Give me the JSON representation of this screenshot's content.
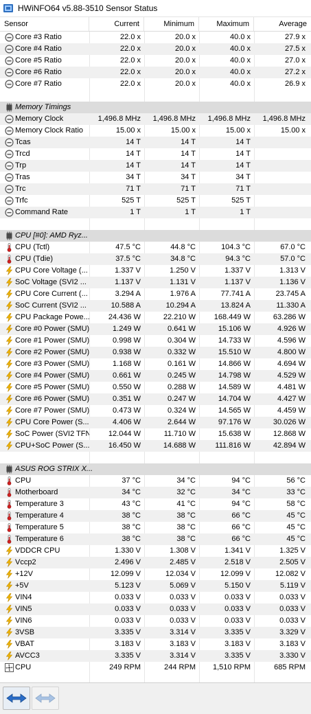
{
  "window": {
    "title": "HWiNFO64 v5.88-3510 Sensor Status"
  },
  "columns": {
    "sensor": "Sensor",
    "current": "Current",
    "minimum": "Minimum",
    "maximum": "Maximum",
    "average": "Average"
  },
  "rows": [
    {
      "type": "item",
      "icon": "clock",
      "name": "Core #3 Ratio",
      "cur": "22.0 x",
      "min": "20.0 x",
      "max": "40.0 x",
      "avg": "27.9 x"
    },
    {
      "type": "item",
      "icon": "clock",
      "name": "Core #4 Ratio",
      "cur": "22.0 x",
      "min": "20.0 x",
      "max": "40.0 x",
      "avg": "27.5 x"
    },
    {
      "type": "item",
      "icon": "clock",
      "name": "Core #5 Ratio",
      "cur": "22.0 x",
      "min": "20.0 x",
      "max": "40.0 x",
      "avg": "27.0 x"
    },
    {
      "type": "item",
      "icon": "clock",
      "name": "Core #6 Ratio",
      "cur": "22.0 x",
      "min": "20.0 x",
      "max": "40.0 x",
      "avg": "27.2 x"
    },
    {
      "type": "item",
      "icon": "clock",
      "name": "Core #7 Ratio",
      "cur": "22.0 x",
      "min": "20.0 x",
      "max": "40.0 x",
      "avg": "26.9 x"
    },
    {
      "type": "blank"
    },
    {
      "type": "group",
      "icon": "chip",
      "name": "Memory Timings"
    },
    {
      "type": "item",
      "icon": "clock",
      "name": "Memory Clock",
      "cur": "1,496.8 MHz",
      "min": "1,496.8 MHz",
      "max": "1,496.8 MHz",
      "avg": "1,496.8 MHz"
    },
    {
      "type": "item",
      "icon": "clock",
      "name": "Memory Clock Ratio",
      "cur": "15.00 x",
      "min": "15.00 x",
      "max": "15.00 x",
      "avg": "15.00 x"
    },
    {
      "type": "item",
      "icon": "clock",
      "name": "Tcas",
      "cur": "14 T",
      "min": "14 T",
      "max": "14 T",
      "avg": ""
    },
    {
      "type": "item",
      "icon": "clock",
      "name": "Trcd",
      "cur": "14 T",
      "min": "14 T",
      "max": "14 T",
      "avg": ""
    },
    {
      "type": "item",
      "icon": "clock",
      "name": "Trp",
      "cur": "14 T",
      "min": "14 T",
      "max": "14 T",
      "avg": ""
    },
    {
      "type": "item",
      "icon": "clock",
      "name": "Tras",
      "cur": "34 T",
      "min": "34 T",
      "max": "34 T",
      "avg": ""
    },
    {
      "type": "item",
      "icon": "clock",
      "name": "Trc",
      "cur": "71 T",
      "min": "71 T",
      "max": "71 T",
      "avg": ""
    },
    {
      "type": "item",
      "icon": "clock",
      "name": "Trfc",
      "cur": "525 T",
      "min": "525 T",
      "max": "525 T",
      "avg": ""
    },
    {
      "type": "item",
      "icon": "clock",
      "name": "Command Rate",
      "cur": "1 T",
      "min": "1 T",
      "max": "1 T",
      "avg": ""
    },
    {
      "type": "blank"
    },
    {
      "type": "group",
      "icon": "chip",
      "name": "CPU [#0]: AMD Ryz..."
    },
    {
      "type": "item",
      "icon": "thermo",
      "name": "CPU (Tctl)",
      "cur": "47.5 °C",
      "min": "44.8 °C",
      "max": "104.3 °C",
      "avg": "67.0 °C"
    },
    {
      "type": "item",
      "icon": "thermo",
      "name": "CPU (Tdie)",
      "cur": "37.5 °C",
      "min": "34.8 °C",
      "max": "94.3 °C",
      "avg": "57.0 °C"
    },
    {
      "type": "item",
      "icon": "bolt",
      "name": "CPU Core Voltage (...",
      "cur": "1.337 V",
      "min": "1.250 V",
      "max": "1.337 V",
      "avg": "1.313 V"
    },
    {
      "type": "item",
      "icon": "bolt",
      "name": "SoC Voltage (SVI2 ...",
      "cur": "1.137 V",
      "min": "1.131 V",
      "max": "1.137 V",
      "avg": "1.136 V"
    },
    {
      "type": "item",
      "icon": "bolt",
      "name": "CPU Core Current (...",
      "cur": "3.294 A",
      "min": "1.976 A",
      "max": "77.741 A",
      "avg": "23.745 A"
    },
    {
      "type": "item",
      "icon": "bolt",
      "name": "SoC Current (SVI2 ...",
      "cur": "10.588 A",
      "min": "10.294 A",
      "max": "13.824 A",
      "avg": "11.330 A"
    },
    {
      "type": "item",
      "icon": "bolt",
      "name": "CPU Package Powe...",
      "cur": "24.436 W",
      "min": "22.210 W",
      "max": "168.449 W",
      "avg": "63.286 W"
    },
    {
      "type": "item",
      "icon": "bolt",
      "name": "Core #0 Power (SMU)",
      "cur": "1.249 W",
      "min": "0.641 W",
      "max": "15.106 W",
      "avg": "4.926 W"
    },
    {
      "type": "item",
      "icon": "bolt",
      "name": "Core #1 Power (SMU)",
      "cur": "0.998 W",
      "min": "0.304 W",
      "max": "14.733 W",
      "avg": "4.596 W"
    },
    {
      "type": "item",
      "icon": "bolt",
      "name": "Core #2 Power (SMU)",
      "cur": "0.938 W",
      "min": "0.332 W",
      "max": "15.510 W",
      "avg": "4.800 W"
    },
    {
      "type": "item",
      "icon": "bolt",
      "name": "Core #3 Power (SMU)",
      "cur": "1.168 W",
      "min": "0.161 W",
      "max": "14.866 W",
      "avg": "4.694 W"
    },
    {
      "type": "item",
      "icon": "bolt",
      "name": "Core #4 Power (SMU)",
      "cur": "0.661 W",
      "min": "0.245 W",
      "max": "14.798 W",
      "avg": "4.529 W"
    },
    {
      "type": "item",
      "icon": "bolt",
      "name": "Core #5 Power (SMU)",
      "cur": "0.550 W",
      "min": "0.288 W",
      "max": "14.589 W",
      "avg": "4.481 W"
    },
    {
      "type": "item",
      "icon": "bolt",
      "name": "Core #6 Power (SMU)",
      "cur": "0.351 W",
      "min": "0.247 W",
      "max": "14.704 W",
      "avg": "4.427 W"
    },
    {
      "type": "item",
      "icon": "bolt",
      "name": "Core #7 Power (SMU)",
      "cur": "0.473 W",
      "min": "0.324 W",
      "max": "14.565 W",
      "avg": "4.459 W"
    },
    {
      "type": "item",
      "icon": "bolt",
      "name": "CPU Core Power (S...",
      "cur": "4.406 W",
      "min": "2.644 W",
      "max": "97.176 W",
      "avg": "30.026 W"
    },
    {
      "type": "item",
      "icon": "bolt",
      "name": "SoC Power (SVI2 TFN)",
      "cur": "12.044 W",
      "min": "11.710 W",
      "max": "15.638 W",
      "avg": "12.868 W"
    },
    {
      "type": "item",
      "icon": "bolt",
      "name": "CPU+SoC Power (S...",
      "cur": "16.450 W",
      "min": "14.688 W",
      "max": "111.816 W",
      "avg": "42.894 W"
    },
    {
      "type": "blank"
    },
    {
      "type": "group",
      "icon": "chip",
      "name": "ASUS ROG STRIX X..."
    },
    {
      "type": "item",
      "icon": "thermo",
      "name": "CPU",
      "cur": "37 °C",
      "min": "34 °C",
      "max": "94 °C",
      "avg": "56 °C"
    },
    {
      "type": "item",
      "icon": "thermo",
      "name": "Motherboard",
      "cur": "34 °C",
      "min": "32 °C",
      "max": "34 °C",
      "avg": "33 °C"
    },
    {
      "type": "item",
      "icon": "thermo",
      "name": "Temperature 3",
      "cur": "43 °C",
      "min": "41 °C",
      "max": "94 °C",
      "avg": "58 °C"
    },
    {
      "type": "item",
      "icon": "thermo",
      "name": "Temperature 4",
      "cur": "38 °C",
      "min": "38 °C",
      "max": "66 °C",
      "avg": "45 °C"
    },
    {
      "type": "item",
      "icon": "thermo",
      "name": "Temperature 5",
      "cur": "38 °C",
      "min": "38 °C",
      "max": "66 °C",
      "avg": "45 °C"
    },
    {
      "type": "item",
      "icon": "thermo",
      "name": "Temperature 6",
      "cur": "38 °C",
      "min": "38 °C",
      "max": "66 °C",
      "avg": "45 °C"
    },
    {
      "type": "item",
      "icon": "bolt",
      "name": "VDDCR CPU",
      "cur": "1.330 V",
      "min": "1.308 V",
      "max": "1.341 V",
      "avg": "1.325 V"
    },
    {
      "type": "item",
      "icon": "bolt",
      "name": "Vccp2",
      "cur": "2.496 V",
      "min": "2.485 V",
      "max": "2.518 V",
      "avg": "2.505 V"
    },
    {
      "type": "item",
      "icon": "bolt",
      "name": "+12V",
      "cur": "12.099 V",
      "min": "12.034 V",
      "max": "12.099 V",
      "avg": "12.082 V"
    },
    {
      "type": "item",
      "icon": "bolt",
      "name": "+5V",
      "cur": "5.123 V",
      "min": "5.069 V",
      "max": "5.150 V",
      "avg": "5.119 V"
    },
    {
      "type": "item",
      "icon": "bolt",
      "name": "VIN4",
      "cur": "0.033 V",
      "min": "0.033 V",
      "max": "0.033 V",
      "avg": "0.033 V"
    },
    {
      "type": "item",
      "icon": "bolt",
      "name": "VIN5",
      "cur": "0.033 V",
      "min": "0.033 V",
      "max": "0.033 V",
      "avg": "0.033 V"
    },
    {
      "type": "item",
      "icon": "bolt",
      "name": "VIN6",
      "cur": "0.033 V",
      "min": "0.033 V",
      "max": "0.033 V",
      "avg": "0.033 V"
    },
    {
      "type": "item",
      "icon": "bolt",
      "name": "3VSB",
      "cur": "3.335 V",
      "min": "3.314 V",
      "max": "3.335 V",
      "avg": "3.329 V"
    },
    {
      "type": "item",
      "icon": "bolt",
      "name": "VBAT",
      "cur": "3.183 V",
      "min": "3.183 V",
      "max": "3.183 V",
      "avg": "3.183 V"
    },
    {
      "type": "item",
      "icon": "bolt",
      "name": "AVCC3",
      "cur": "3.335 V",
      "min": "3.314 V",
      "max": "3.335 V",
      "avg": "3.330 V"
    },
    {
      "type": "item",
      "icon": "fan",
      "name": "CPU",
      "cur": "249 RPM",
      "min": "244 RPM",
      "max": "1,510 RPM",
      "avg": "685 RPM"
    }
  ],
  "colors": {
    "alt_row": "#f0f0f0",
    "group_row": "#dcdcdc",
    "bolt": "#f2b600",
    "thermo": "#d32020",
    "button_arrow": "#2a6dc9"
  },
  "footer": {
    "buttons": [
      "navigate-button",
      "navigate-button-disabled"
    ]
  }
}
